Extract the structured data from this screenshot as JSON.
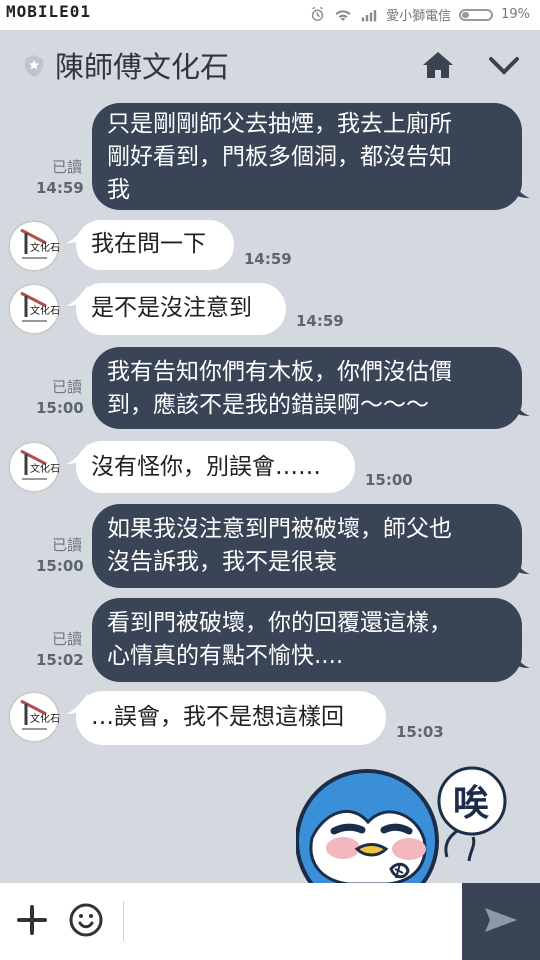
{
  "status_bar": {
    "watermark": "MOBILE01",
    "carrier": "愛小獅電信",
    "battery_pct": "19%"
  },
  "header": {
    "title": "陳師傅文化石"
  },
  "messages": [
    {
      "type": "sent",
      "text": "只是剛剛師父去抽煙，我去上廁所\n剛好看到，門板多個洞，都沒告知\n我",
      "read": "已讀",
      "time": "14:59"
    },
    {
      "type": "recv",
      "text": "我在問一下",
      "time": "14:59"
    },
    {
      "type": "recv",
      "text": "是不是沒注意到",
      "time": "14:59"
    },
    {
      "type": "sent",
      "text": "我有告知你們有木板，你們沒估價\n到，應該不是我的錯誤啊～～～",
      "read": "已讀",
      "time": "15:00"
    },
    {
      "type": "recv",
      "text": "沒有怪你，別誤會……",
      "time": "15:00"
    },
    {
      "type": "sent",
      "text": "如果我沒注意到門被破壞，師父也\n沒告訴我，我不是很衰",
      "read": "已讀",
      "time": "15:00"
    },
    {
      "type": "sent",
      "text": "看到門被破壞，你的回覆還這樣，\n心情真的有點不愉快....",
      "read": "已讀",
      "time": "15:02"
    },
    {
      "type": "recv",
      "text": "…誤會，我不是想這樣回",
      "time": "15:03"
    }
  ],
  "sticker": {
    "text": "唉"
  },
  "input": {
    "placeholder": ""
  },
  "icons": {
    "header_left": "shield-star-icon",
    "header_home": "home-icon",
    "header_menu": "chevron-down-icon",
    "status_alarm": "alarm-icon",
    "status_wifi": "wifi-icon",
    "status_signal": "signal-icon",
    "status_battery": "battery-icon",
    "input_add": "plus-icon",
    "input_emoji": "emoji-icon",
    "input_send": "send-icon"
  },
  "colors": {
    "background": "#d4d9e0",
    "sent_bubble": "#3a4457",
    "received_bubble": "#ffffff",
    "text_dark": "#202020",
    "meta_text": "#6e7682"
  }
}
